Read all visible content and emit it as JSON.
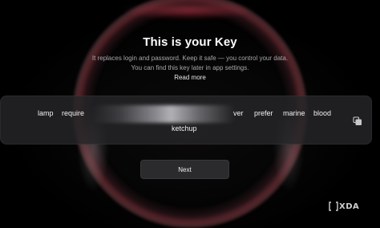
{
  "heading": {
    "title": "This is your Key",
    "subtitle_line1": "It replaces login and password. Keep it safe — you control your data.",
    "subtitle_line2": "You can find this key later in app settings.",
    "read_more": "Read more"
  },
  "key_phrase": {
    "words": [
      "lamp",
      "require",
      "ver",
      "prefer",
      "marine",
      "blood",
      "ketchup"
    ],
    "partially_hidden": true
  },
  "actions": {
    "next_label": "Next"
  },
  "watermark": {
    "text": "XDA"
  },
  "colors": {
    "background": "#000000",
    "panel": "#262628",
    "ring_accent": "#c83c50",
    "button": "#2b2b2d",
    "text_primary": "#ffffff",
    "text_secondary": "#a9a9ad"
  },
  "icons": {
    "copy": "copy-icon",
    "watermark_logo": "xda-logo"
  }
}
